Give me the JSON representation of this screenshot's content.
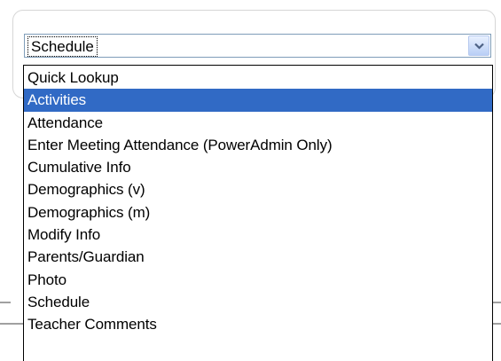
{
  "select": {
    "value": "Schedule",
    "arrow_icon": "chevron-down-icon",
    "accent_color": "#316ac5"
  },
  "dropdown": {
    "selected_index": 1,
    "options": [
      "Quick Lookup",
      "Activities",
      "Attendance",
      "Enter Meeting Attendance (PowerAdmin Only)",
      "Cumulative Info",
      "Demographics (v)",
      "Demographics (m)",
      "Modify Info",
      "Parents/Guardian",
      "Photo",
      "Schedule",
      "Teacher Comments"
    ]
  }
}
